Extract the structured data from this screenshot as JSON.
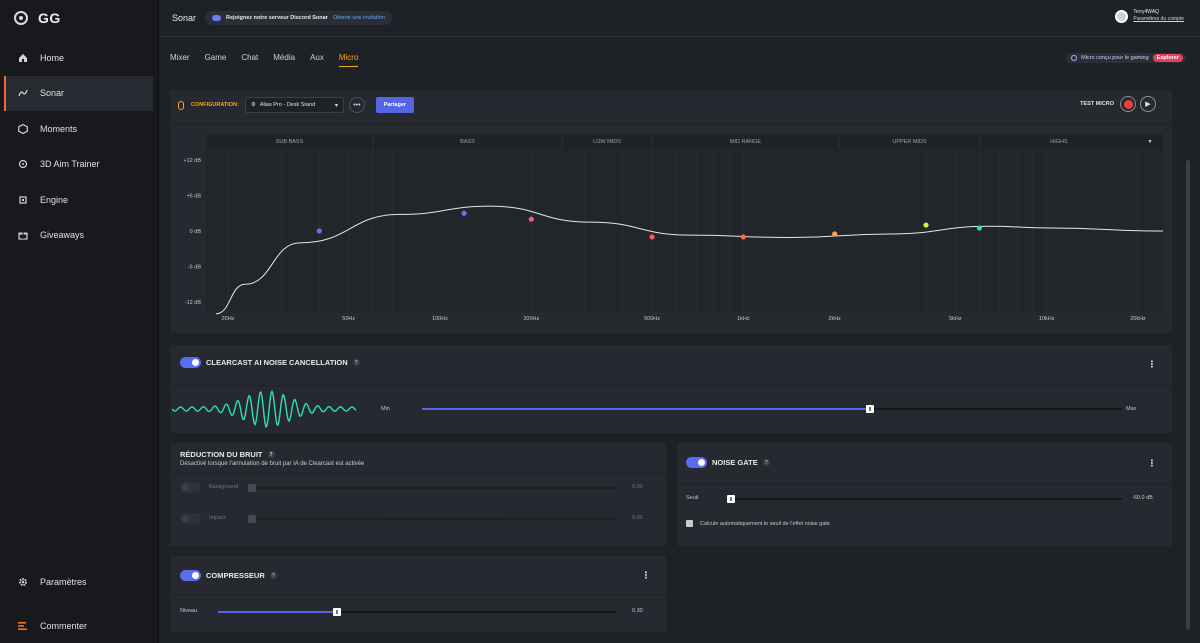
{
  "app": {
    "logo_text": "GG",
    "title": "Sonar"
  },
  "sidebar": {
    "items": [
      {
        "label": "Home",
        "icon": "home-icon"
      },
      {
        "label": "Sonar",
        "icon": "sonar-icon"
      },
      {
        "label": "Moments",
        "icon": "moments-icon"
      },
      {
        "label": "3D Aim Trainer",
        "icon": "aim-trainer-icon"
      },
      {
        "label": "Engine",
        "icon": "engine-icon"
      },
      {
        "label": "Giveaways",
        "icon": "giveaways-icon"
      }
    ],
    "bottom": [
      {
        "label": "Paramètres",
        "icon": "gear-icon"
      },
      {
        "label": "Commenter",
        "icon": "feedback-icon"
      }
    ]
  },
  "topbar": {
    "discord_text": "Rejoignez notre serveur Discord Sonar",
    "discord_link": "Obtenir une invitation",
    "account_name": "Terry4WAQ",
    "account_link": "Paramètres du compte"
  },
  "tabs": [
    "Mixer",
    "Game",
    "Chat",
    "Média",
    "Aux",
    "Micro"
  ],
  "active_tab": "Micro",
  "promo": {
    "text": "Micro conçu pour le gaming",
    "cta": "Explorer"
  },
  "config": {
    "label": "CONFIGURATION:",
    "selected": "Alias Pro - Desk Stand",
    "share_label": "Partager",
    "test_label": "TEST MICRO"
  },
  "eq": {
    "bands": [
      "SUB BASS",
      "BASS",
      "LOW MIDS",
      "MID RANGE",
      "UPPER MIDS",
      "HIGHS"
    ],
    "y_ticks": [
      "+12 dB",
      "+6 dB",
      "0 dB",
      "-6 dB",
      "-12 dB"
    ],
    "x_ticks": [
      "20Hz",
      "50Hz",
      "100Hz",
      "200Hz",
      "500Hz",
      "1kHz",
      "2kHz",
      "5kHz",
      "10kHz",
      "20kHz"
    ],
    "points": [
      {
        "freq": 40,
        "gain": 0,
        "color": "#7b61ff"
      },
      {
        "freq": 120,
        "gain": 3,
        "color": "#6a6df5"
      },
      {
        "freq": 200,
        "gain": 2,
        "color": "#ff4fa3"
      },
      {
        "freq": 500,
        "gain": -1,
        "color": "#ff5a5a"
      },
      {
        "freq": 1000,
        "gain": -1,
        "color": "#ff6a3d"
      },
      {
        "freq": 2000,
        "gain": -0.5,
        "color": "#ffa53d"
      },
      {
        "freq": 4000,
        "gain": 1,
        "color": "#d8f03d"
      },
      {
        "freq": 6000,
        "gain": 0.5,
        "color": "#2de0b0"
      }
    ]
  },
  "clearcast": {
    "title": "CLEARCAST AI NOISE CANCELLATION",
    "min_label": "Min",
    "max_label": "Max",
    "level": 0.64,
    "wave_color": "#2de0b0"
  },
  "noise_reduction": {
    "title": "RÉDUCTION DU BRUIT",
    "subtitle": "Désactivé lorsque l'annulation de bruit par IA de Clearcast est activée",
    "rows": [
      {
        "label": "Background",
        "value": "0.00"
      },
      {
        "label": "Impact",
        "value": "0.00"
      }
    ]
  },
  "noise_gate": {
    "title": "NOISE GATE",
    "threshold_label": "Seuil",
    "threshold_value": "-60.0 dB",
    "checkbox_label": "Calcule automatiquement le seuil de l'effet noise gate"
  },
  "compressor": {
    "title": "COMPRESSEUR",
    "level_label": "Niveau",
    "level_value": "0.30",
    "level": 0.3
  },
  "colors": {
    "accent": "#f5a623",
    "toggle": "#5a6cf0",
    "slider": "#5465e5",
    "record": "#e94040"
  }
}
